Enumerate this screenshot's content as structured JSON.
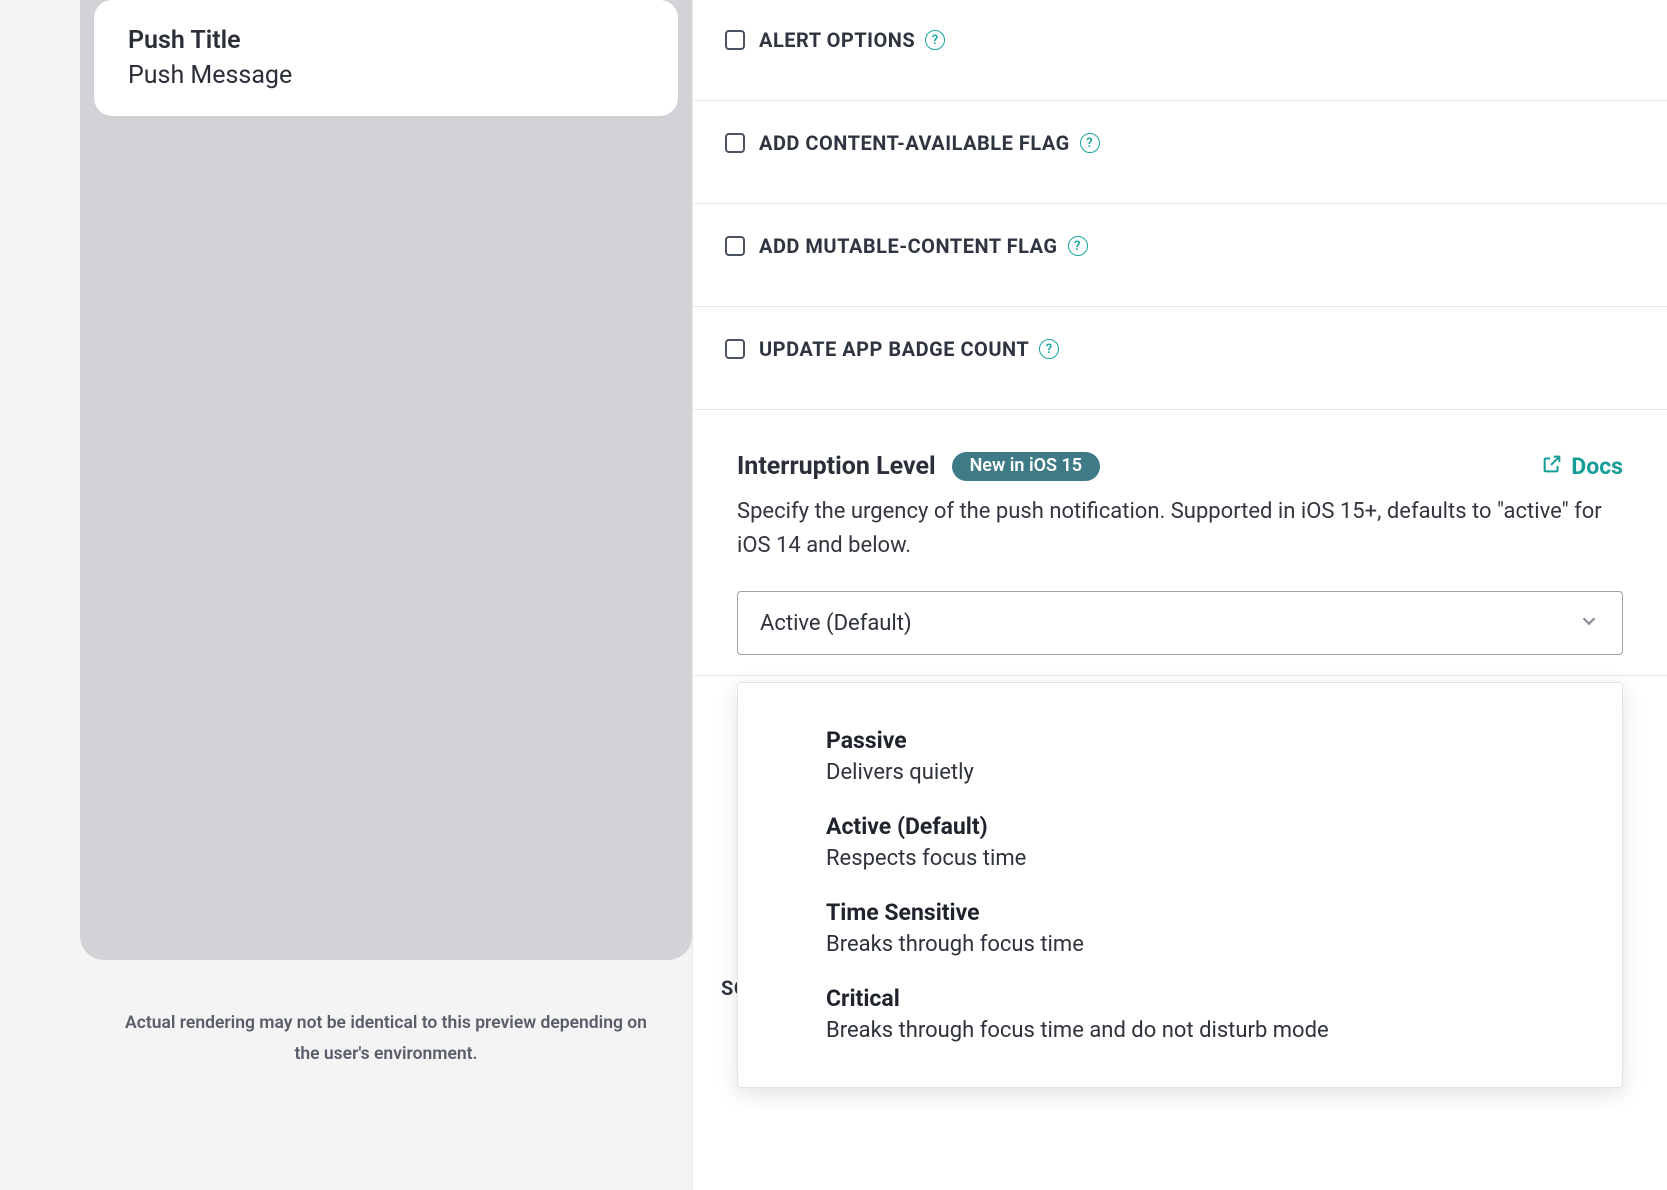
{
  "preview": {
    "push_title": "Push Title",
    "push_message": "Push Message",
    "note": "Actual rendering may not be identical to this preview depending on the user's environment."
  },
  "options": [
    {
      "label": "ALERT OPTIONS",
      "checked": false
    },
    {
      "label": "ADD CONTENT-AVAILABLE FLAG",
      "checked": false
    },
    {
      "label": "ADD MUTABLE-CONTENT FLAG",
      "checked": false
    },
    {
      "label": "UPDATE APP BADGE COUNT",
      "checked": false
    }
  ],
  "interruption": {
    "title": "Interruption Level",
    "badge": "New in iOS 15",
    "docs_label": "Docs",
    "description": "Specify the urgency of the push notification. Supported in iOS 15+, defaults to \"active\" for iOS 14 and below.",
    "selected": "Active (Default)",
    "options": [
      {
        "title": "Passive",
        "desc": "Delivers quietly"
      },
      {
        "title": "Active (Default)",
        "desc": "Respects focus time"
      },
      {
        "title": "Time Sensitive",
        "desc": "Breaks through focus time"
      },
      {
        "title": "Critical",
        "desc": "Breaks through focus time and do not disturb mode"
      }
    ]
  },
  "sound": {
    "label": "SOUND"
  },
  "help_glyph": "?"
}
